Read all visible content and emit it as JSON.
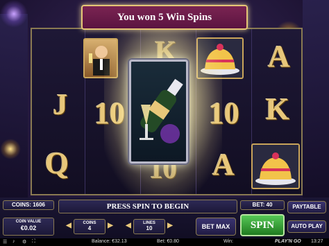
{
  "banner": {
    "text": "You won 5 Win Spins"
  },
  "reels": {
    "col1": [
      "J",
      "Q"
    ],
    "col2": [
      "K",
      "10",
      "10"
    ],
    "col4": [
      "10",
      "A"
    ],
    "col5": [
      "A",
      "K"
    ]
  },
  "hud": {
    "coins_label": "COINS: 1606",
    "message": "PRESS SPIN TO BEGIN",
    "bet_label": "BET: 40",
    "coin_value_title": "COIN VALUE",
    "coin_value": "€0.02",
    "coins_title": "COINS",
    "coins_value": "4",
    "lines_title": "LINES",
    "lines_value": "10",
    "bet_max": "BET MAX",
    "spin": "SPIN",
    "paytable": "PAYTABLE",
    "auto_play": "AUTO PLAY"
  },
  "status": {
    "balance": "Balance: €32.13",
    "bet": "Bet: €0.80",
    "win": "Win:",
    "time": "13:27",
    "brand": "PLAY'N GO"
  },
  "colors": {
    "gold": "#e8c77a",
    "banner": "#7a2452",
    "spin_green": "#2e9a2e",
    "panel": "#2e2a55"
  }
}
